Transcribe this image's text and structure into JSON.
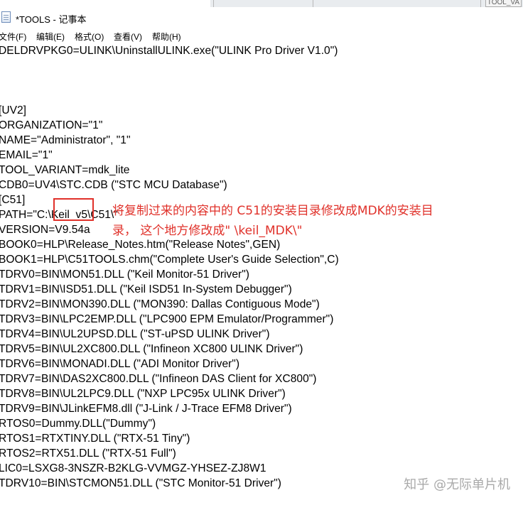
{
  "window": {
    "title": "*TOOLS - 记事本",
    "background_title": "TOOL_VA"
  },
  "menu": {
    "items": [
      "文件(F)",
      "编辑(E)",
      "格式(O)",
      "查看(V)",
      "帮助(H)"
    ]
  },
  "editor": {
    "lines": [
      "DELDRVPKG0=ULINK\\UninstallULINK.exe(\"ULINK Pro Driver V1.0\")",
      "",
      "",
      "",
      "[UV2]",
      "ORGANIZATION=\"1\"",
      "NAME=\"Administrator\", \"1\"",
      "EMAIL=\"1\"",
      "TOOL_VARIANT=mdk_lite",
      "CDB0=UV4\\STC.CDB (\"STC MCU Database\")",
      "[C51]",
      "PATH=\"C:\\Keil_v5\\C51\\\"",
      "VERSION=V9.54a",
      "BOOK0=HLP\\Release_Notes.htm(\"Release Notes\",GEN)",
      "BOOK1=HLP\\C51TOOLS.chm(\"Complete User's Guide Selection\",C)",
      "TDRV0=BIN\\MON51.DLL (\"Keil Monitor-51 Driver\")",
      "TDRV1=BIN\\ISD51.DLL (\"Keil ISD51 In-System Debugger\")",
      "TDRV2=BIN\\MON390.DLL (\"MON390: Dallas Contiguous Mode\")",
      "TDRV3=BIN\\LPC2EMP.DLL (\"LPC900 EPM Emulator/Programmer\")",
      "TDRV4=BIN\\UL2UPSD.DLL (\"ST-uPSD ULINK Driver\")",
      "TDRV5=BIN\\UL2XC800.DLL (\"Infineon XC800 ULINK Driver\")",
      "TDRV6=BIN\\MONADI.DLL (\"ADI Monitor Driver\")",
      "TDRV7=BIN\\DAS2XC800.DLL (\"Infineon DAS Client for XC800\")",
      "TDRV8=BIN\\UL2LPC9.DLL (\"NXP LPC95x ULINK Driver\")",
      "TDRV9=BIN\\JLinkEFM8.dll (\"J-Link / J-Trace EFM8 Driver\")",
      "RTOS0=Dummy.DLL(\"Dummy\")",
      "RTOS1=RTXTINY.DLL (\"RTX-51 Tiny\")",
      "RTOS2=RTX51.DLL (\"RTX-51 Full\")",
      "LIC0=LSXG8-3NSZR-B2KLG-VVMGZ-YHSEZ-ZJ8W1",
      "TDRV10=BIN\\STCMON51.DLL (\"STC Monitor-51 Driver\")"
    ]
  },
  "annotation": {
    "line1": "将复制过来的内容中的 C51的安装目录修改成MDK的安装目",
    "line2": "录，  这个地方修改成\" \\keil_MDK\\\"",
    "color": "#e0312a"
  },
  "watermark": {
    "text": "知乎 @无际单片机"
  }
}
